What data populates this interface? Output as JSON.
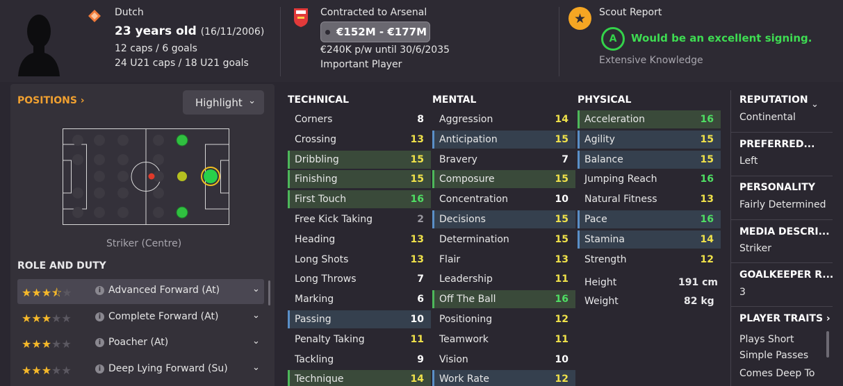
{
  "header": {
    "nationality": "Dutch",
    "age_text": "23 years old",
    "dob": "(16/11/2006)",
    "caps": "12 caps / 6 goals",
    "u21_caps": "24 U21 caps / 18 U21 goals",
    "contract_text": "Contracted to Arsenal",
    "value_range": "€152M - €177M",
    "wage_text": "€240K p/w until 30/6/2035",
    "squad_status": "Important Player",
    "scout_title": "Scout Report",
    "scout_grade": "A",
    "scout_summary": "Would be an excellent signing.",
    "scout_knowledge": "Extensive Knowledge"
  },
  "positions": {
    "link_label": "POSITIONS",
    "highlight_label": "Highlight",
    "position_name": "Striker (Centre)"
  },
  "roles": {
    "title": "ROLE AND DUTY",
    "items": [
      {
        "name": "Advanced Forward (At)",
        "stars": 3.5,
        "selected": true
      },
      {
        "name": "Complete Forward (At)",
        "stars": 3,
        "selected": false
      },
      {
        "name": "Poacher (At)",
        "stars": 3,
        "selected": false
      },
      {
        "name": "Deep Lying Forward (Su)",
        "stars": 3,
        "selected": false
      }
    ]
  },
  "technical": {
    "title": "TECHNICAL",
    "items": [
      {
        "name": "Corners",
        "value": "8",
        "hl": ""
      },
      {
        "name": "Crossing",
        "value": "13",
        "hl": ""
      },
      {
        "name": "Dribbling",
        "value": "15",
        "hl": "green"
      },
      {
        "name": "Finishing",
        "value": "15",
        "hl": "green"
      },
      {
        "name": "First Touch",
        "value": "16",
        "hl": "green"
      },
      {
        "name": "Free Kick Taking",
        "value": "2",
        "hl": ""
      },
      {
        "name": "Heading",
        "value": "13",
        "hl": ""
      },
      {
        "name": "Long Shots",
        "value": "13",
        "hl": ""
      },
      {
        "name": "Long Throws",
        "value": "7",
        "hl": ""
      },
      {
        "name": "Marking",
        "value": "6",
        "hl": ""
      },
      {
        "name": "Passing",
        "value": "10",
        "hl": "blue"
      },
      {
        "name": "Penalty Taking",
        "value": "11",
        "hl": ""
      },
      {
        "name": "Tackling",
        "value": "9",
        "hl": ""
      },
      {
        "name": "Technique",
        "value": "14",
        "hl": "green"
      }
    ]
  },
  "mental": {
    "title": "MENTAL",
    "items": [
      {
        "name": "Aggression",
        "value": "14",
        "hl": ""
      },
      {
        "name": "Anticipation",
        "value": "15",
        "hl": "blue"
      },
      {
        "name": "Bravery",
        "value": "7",
        "hl": ""
      },
      {
        "name": "Composure",
        "value": "15",
        "hl": "green"
      },
      {
        "name": "Concentration",
        "value": "10",
        "hl": ""
      },
      {
        "name": "Decisions",
        "value": "15",
        "hl": "blue"
      },
      {
        "name": "Determination",
        "value": "15",
        "hl": ""
      },
      {
        "name": "Flair",
        "value": "13",
        "hl": ""
      },
      {
        "name": "Leadership",
        "value": "11",
        "hl": ""
      },
      {
        "name": "Off The Ball",
        "value": "16",
        "hl": "green"
      },
      {
        "name": "Positioning",
        "value": "12",
        "hl": ""
      },
      {
        "name": "Teamwork",
        "value": "11",
        "hl": ""
      },
      {
        "name": "Vision",
        "value": "10",
        "hl": ""
      },
      {
        "name": "Work Rate",
        "value": "12",
        "hl": "blue"
      }
    ]
  },
  "physical": {
    "title": "PHYSICAL",
    "items": [
      {
        "name": "Acceleration",
        "value": "16",
        "hl": "green"
      },
      {
        "name": "Agility",
        "value": "15",
        "hl": "blue"
      },
      {
        "name": "Balance",
        "value": "15",
        "hl": "blue"
      },
      {
        "name": "Jumping Reach",
        "value": "16",
        "hl": ""
      },
      {
        "name": "Natural Fitness",
        "value": "13",
        "hl": ""
      },
      {
        "name": "Pace",
        "value": "16",
        "hl": "blue"
      },
      {
        "name": "Stamina",
        "value": "14",
        "hl": "blue"
      },
      {
        "name": "Strength",
        "value": "12",
        "hl": ""
      }
    ],
    "height_label": "Height",
    "height_value": "191 cm",
    "weight_label": "Weight",
    "weight_value": "82 kg"
  },
  "info": {
    "reputation_title": "REPUTATION",
    "reputation_value": "Continental",
    "foot_title": "PREFERRED...",
    "foot_value": "Left",
    "personality_title": "PERSONALITY",
    "personality_value": "Fairly Determined",
    "media_title": "MEDIA DESCRI...",
    "media_value": "Striker",
    "gk_title": "GOALKEEPER R...",
    "gk_value": "3",
    "traits_title": "PLAYER TRAITS",
    "traits": [
      "Plays Short",
      "Simple Passes",
      "Comes Deep To"
    ]
  },
  "colors": {
    "accent_orange": "#f0a030",
    "rating_high": "#4fde63",
    "rating_mid": "#f0e24a",
    "scout_green": "#3edc52"
  }
}
